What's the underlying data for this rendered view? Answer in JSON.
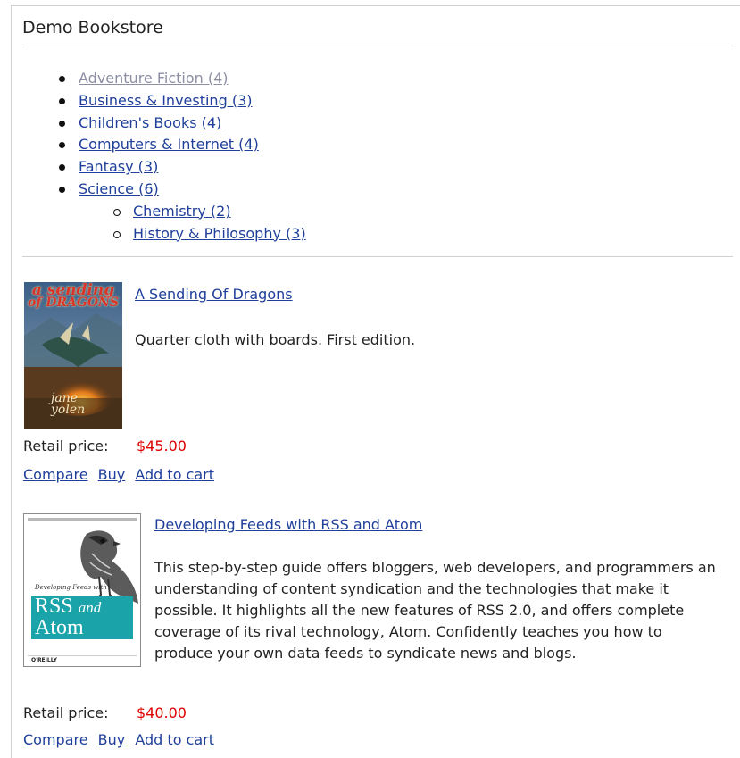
{
  "store": {
    "title": "Demo Bookstore"
  },
  "categories": [
    {
      "label": "Adventure Fiction (4)",
      "visited": true
    },
    {
      "label": "Business & Investing (3)"
    },
    {
      "label": "Children's Books (4)"
    },
    {
      "label": "Computers & Internet (4)"
    },
    {
      "label": "Fantasy (3)"
    },
    {
      "label": "Science (6)"
    }
  ],
  "subcategories": [
    {
      "label": "Chemistry (2)"
    },
    {
      "label": "History & Philosophy (3)"
    }
  ],
  "products": [
    {
      "title": "A Sending Of Dragons",
      "description": "Quarter cloth with boards. First edition.",
      "price_label": "Retail price:",
      "price": "$45.00",
      "cover": {
        "title_line1": "a sending",
        "title_line2": "of DRAGONS",
        "author_line1": "jane",
        "author_line2": "yolen"
      }
    },
    {
      "title": "Developing Feeds with RSS and Atom",
      "description": "This step-by-step guide offers bloggers, web developers, and programmers an understanding of content syndication and the technologies that make it possible. It highlights all the new features of RSS 2.0, and offers complete coverage of its rival technology, Atom. Confidently teaches you how to produce your own data feeds to syndicate news and blogs.",
      "price_label": "Retail price:",
      "price": "$40.00",
      "cover": {
        "small_title": "Developing Feeds with",
        "main_line1": "RSS",
        "main_and": "and",
        "main_line2": "Atom",
        "publisher": "O'REILLY"
      }
    }
  ],
  "actions": {
    "compare": "Compare",
    "buy": "Buy",
    "add_to_cart": "Add to cart"
  },
  "colors": {
    "link": "#1f3f9a",
    "visited_link": "#8c8fa4",
    "price": "#e00000",
    "rss_cover_teal": "#1aa3a8"
  }
}
